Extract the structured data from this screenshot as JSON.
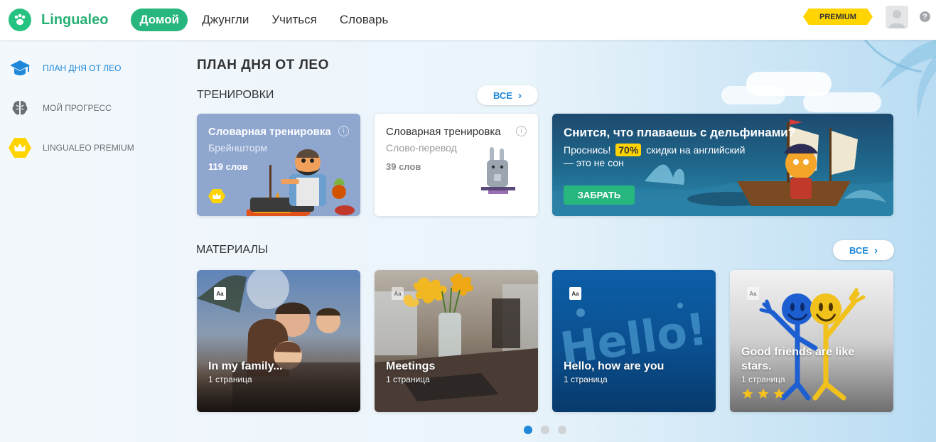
{
  "app": {
    "name": "Lingualeo"
  },
  "nav": [
    {
      "label": "Домой",
      "active": true
    },
    {
      "label": "Джунгли",
      "active": false
    },
    {
      "label": "Учиться",
      "active": false
    },
    {
      "label": "Словарь",
      "active": false
    }
  ],
  "header": {
    "premium": "PREMIUM",
    "help": "?"
  },
  "sidebar": {
    "items": [
      {
        "label": "ПЛАН ДНЯ ОТ ЛЕО",
        "icon": "graduation-cap-icon",
        "active": true
      },
      {
        "label": "МОЙ ПРОГРЕСС",
        "icon": "brain-icon",
        "active": false
      },
      {
        "label": "LINGUALEO PREMIUM",
        "icon": "crown-icon",
        "active": false
      }
    ]
  },
  "main": {
    "title": "ПЛАН ДНЯ ОТ ЛЕО",
    "trainings": {
      "title": "ТРЕНИРОВКИ",
      "all_label": "ВСЕ",
      "cards": [
        {
          "title": "Словарная тренировка",
          "subtitle": "Брейншторм",
          "count": "119 слов",
          "premium": true
        },
        {
          "title": "Словарная тренировка",
          "subtitle": "Слово-перевод",
          "count": "39 слов",
          "premium": false
        }
      ],
      "promo": {
        "title": "Снится, что плаваешь с дельфинами?",
        "line1_prefix": "Проснись!",
        "discount": "70%",
        "line1_suffix": "скидки на английский",
        "line2": "— это не сон",
        "button": "ЗАБРАТЬ"
      }
    },
    "materials": {
      "title": "МАТЕРИАЛЫ",
      "all_label": "ВСЕ",
      "cards": [
        {
          "title": "In my family...",
          "pages": "1 страница"
        },
        {
          "title": "Meetings",
          "pages": "1 страница"
        },
        {
          "title": "Hello, how are you",
          "pages": "1 страница"
        },
        {
          "title": "Good friends are like stars.",
          "pages": "1 страница",
          "stars": 3
        }
      ]
    },
    "pagination": {
      "pages": 3,
      "current": 1
    }
  },
  "colors": {
    "brand_green": "#26b67e",
    "link_blue": "#1f88d9",
    "premium_yellow": "#ffd400"
  }
}
